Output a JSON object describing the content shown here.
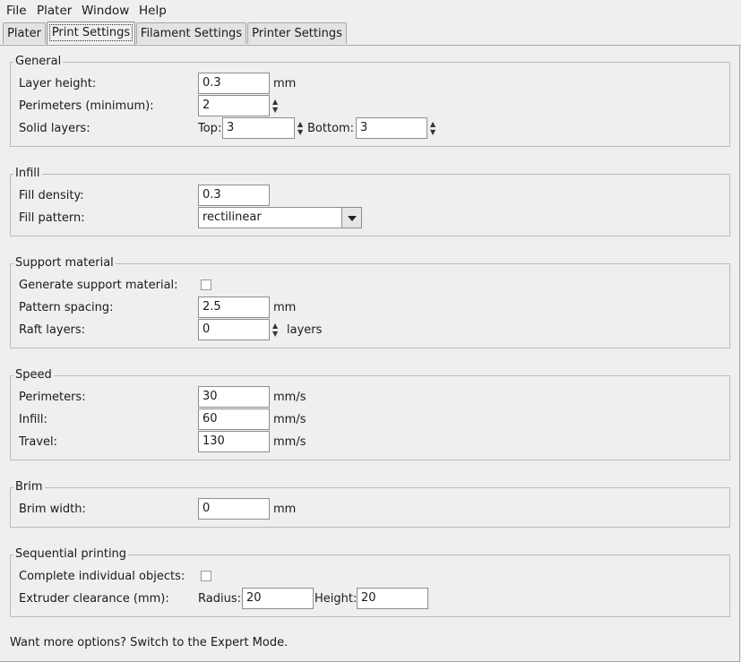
{
  "menu": {
    "file": "File",
    "plater": "Plater",
    "window": "Window",
    "help": "Help"
  },
  "tabs": [
    {
      "label": "Plater"
    },
    {
      "label": "Print Settings"
    },
    {
      "label": "Filament Settings"
    },
    {
      "label": "Printer Settings"
    }
  ],
  "general": {
    "title": "General",
    "layer_height_label": "Layer height:",
    "layer_height_value": "0.3",
    "layer_height_unit": "mm",
    "perimeters_label": "Perimeters (minimum):",
    "perimeters_value": "2",
    "solid_layers_label": "Solid layers:",
    "top_label": "Top:",
    "top_value": "3",
    "bottom_label": "Bottom:",
    "bottom_value": "3"
  },
  "infill": {
    "title": "Infill",
    "density_label": "Fill density:",
    "density_value": "0.3",
    "pattern_label": "Fill pattern:",
    "pattern_value": "rectilinear"
  },
  "support": {
    "title": "Support material",
    "generate_label": "Generate support material:",
    "spacing_label": "Pattern spacing:",
    "spacing_value": "2.5",
    "spacing_unit": "mm",
    "raft_label": "Raft layers:",
    "raft_value": "0",
    "raft_unit": "layers"
  },
  "speed": {
    "title": "Speed",
    "perimeters_label": "Perimeters:",
    "perimeters_value": "30",
    "infill_label": "Infill:",
    "infill_value": "60",
    "travel_label": "Travel:",
    "travel_value": "130",
    "unit": "mm/s"
  },
  "brim": {
    "title": "Brim",
    "width_label": "Brim width:",
    "width_value": "0",
    "unit": "mm"
  },
  "sequential": {
    "title": "Sequential printing",
    "complete_label": "Complete individual objects:",
    "clearance_label": "Extruder clearance (mm):",
    "radius_label": "Radius:",
    "radius_value": "20",
    "height_label": "Height:",
    "height_value": "20"
  },
  "footer": "Want more options? Switch to the Expert Mode."
}
